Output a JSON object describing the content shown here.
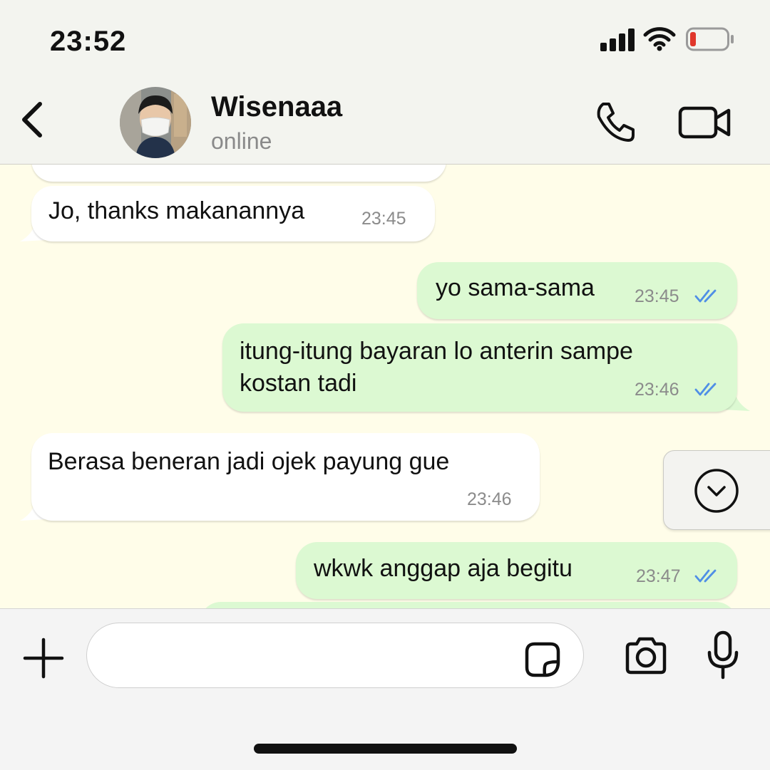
{
  "status_bar": {
    "time": "23:52"
  },
  "header": {
    "contact_name": "Wisenaaa",
    "contact_status": "online"
  },
  "messages": [
    {
      "direction": "incoming",
      "text": "Jo, thanks makanannya",
      "time": "23:45"
    },
    {
      "direction": "outgoing",
      "text": "yo sama-sama",
      "time": "23:45",
      "status": "read"
    },
    {
      "direction": "outgoing",
      "lines": [
        "itung-itung bayaran lo anterin sampe",
        "kostan tadi"
      ],
      "time": "23:46",
      "status": "read"
    },
    {
      "direction": "incoming",
      "text": "Berasa beneran jadi ojek payung gue",
      "time": "23:46"
    },
    {
      "direction": "outgoing",
      "text": "wkwk anggap aja begitu",
      "time": "23:47",
      "status": "read"
    }
  ],
  "composer": {
    "placeholder": ""
  },
  "colors": {
    "chat_background": "#fffde9",
    "outgoing_bubble": "#dcf9d2",
    "incoming_bubble": "#ffffff",
    "read_ticks": "#4f8fe6",
    "battery_low": "#e0372b"
  },
  "icons": [
    "back-chevron-icon",
    "phone-icon",
    "video-camera-icon",
    "chevron-down-icon",
    "plus-icon",
    "sticker-icon",
    "camera-icon",
    "microphone-icon"
  ]
}
